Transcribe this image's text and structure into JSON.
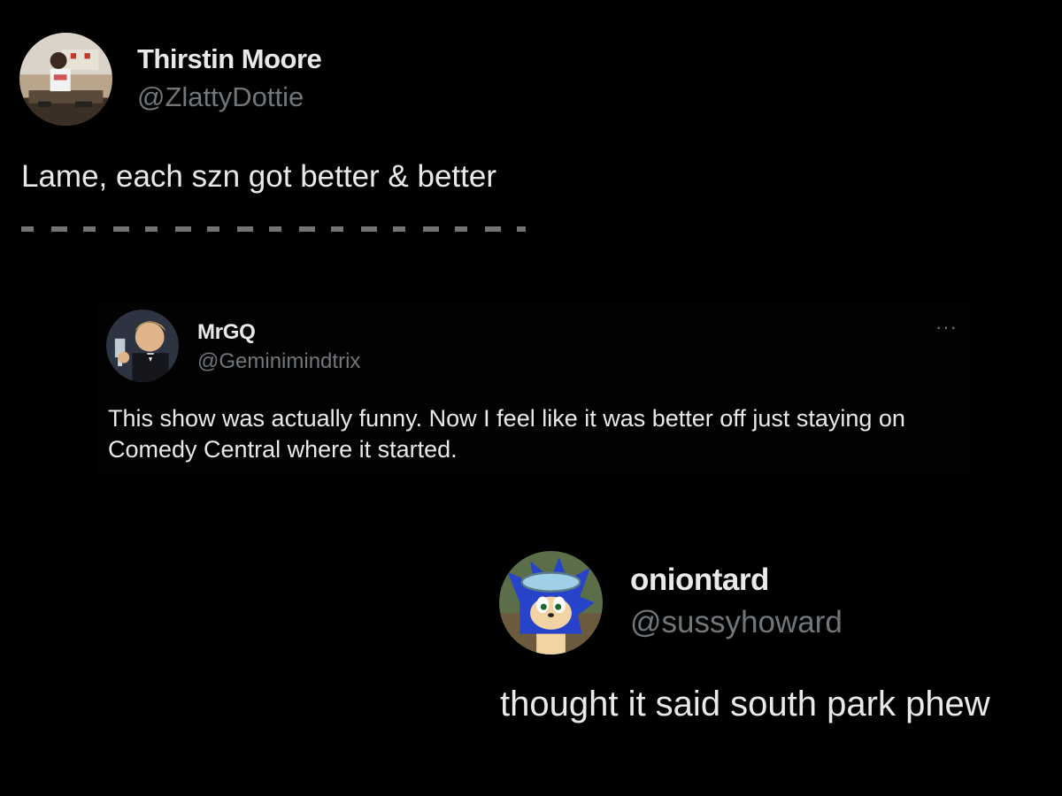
{
  "tweets": [
    {
      "display_name": "Thirstin Moore",
      "handle": "@ZlattyDottie",
      "text": "Lame, each szn got better & better",
      "avatar_icon": "user-avatar-dj"
    },
    {
      "display_name": "MrGQ",
      "handle": "@Geminimindtrix",
      "text": "This show was actually funny. Now I feel like it was better off just staying on Comedy Central where it started.",
      "more_icon": "more-options-icon",
      "more_symbol": "···",
      "avatar_icon": "user-avatar-toast"
    },
    {
      "display_name": "oniontard",
      "handle": "@sussyhoward",
      "text": "thought it said south park phew",
      "avatar_icon": "user-avatar-sonic"
    }
  ],
  "colors": {
    "background": "#000000",
    "primary_text": "#e7e9ea",
    "secondary_text": "#71767b"
  }
}
